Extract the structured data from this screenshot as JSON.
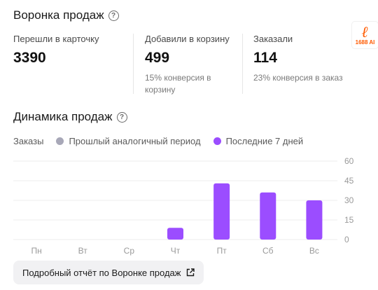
{
  "funnel": {
    "title": "Воронка продаж",
    "metrics": [
      {
        "label": "Перешли в карточку",
        "value": "3390",
        "sub": ""
      },
      {
        "label": "Добавили в корзину",
        "value": "499",
        "sub": "15% конверсия в корзину"
      },
      {
        "label": "Заказали",
        "value": "114",
        "sub": "23% конверсия в заказ"
      }
    ]
  },
  "logo": {
    "mark": "ℓ",
    "text": "1688 AI"
  },
  "dynamics": {
    "title": "Динамика продаж",
    "legend": {
      "metric": "Заказы",
      "previous": "Прошлый аналогичный период",
      "current": "Последние 7 дней"
    }
  },
  "colors": {
    "current": "#9b4dff",
    "previous": "#a8a8b8",
    "grid": "#ececec",
    "axis_text": "#9a9a9a"
  },
  "chart_data": {
    "type": "bar",
    "categories": [
      "Пн",
      "Вт",
      "Ср",
      "Чт",
      "Пт",
      "Сб",
      "Вс"
    ],
    "series": [
      {
        "name": "Последние 7 дней",
        "values": [
          0,
          0,
          0,
          9,
          43,
          36,
          30
        ]
      }
    ],
    "yticks": [
      0,
      15,
      30,
      45,
      60
    ],
    "ylim": [
      0,
      60
    ],
    "y_axis_position": "right",
    "grid": true
  },
  "report_button": {
    "label": "Подробный отчёт по Воронке продаж",
    "icon": "external-link-icon"
  }
}
